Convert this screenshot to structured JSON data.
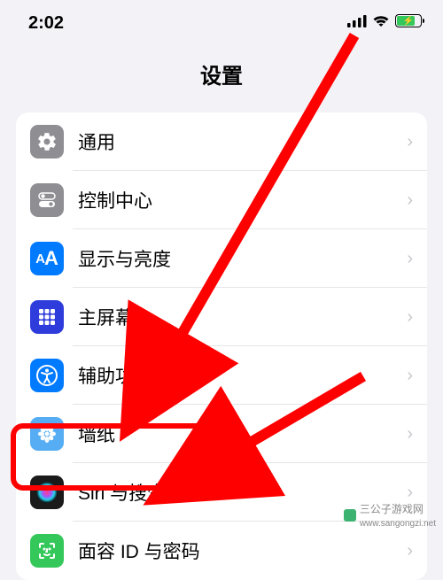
{
  "status": {
    "time": "2:02",
    "signal_strength": 4,
    "wifi": true,
    "battery_charging": true
  },
  "header": {
    "title": "设置"
  },
  "settings_group": [
    {
      "id": "general",
      "label": "通用",
      "icon": "gear-icon",
      "icon_color": "#8e8e93"
    },
    {
      "id": "control-center",
      "label": "控制中心",
      "icon": "switch-icon",
      "icon_color": "#8e8e93"
    },
    {
      "id": "display",
      "label": "显示与亮度",
      "icon": "text-size-icon",
      "icon_color": "#007aff"
    },
    {
      "id": "home-screen",
      "label": "主屏幕",
      "icon": "grid-icon",
      "icon_color": "#2f3cdc"
    },
    {
      "id": "accessibility",
      "label": "辅助功能",
      "icon": "accessibility-icon",
      "icon_color": "#007aff"
    },
    {
      "id": "wallpaper",
      "label": "墙纸",
      "icon": "flower-icon",
      "icon_color": "#56adf3"
    },
    {
      "id": "siri",
      "label": "Siri 与搜索",
      "icon": "siri-icon",
      "icon_color": "#1a1a1a"
    },
    {
      "id": "faceid",
      "label": "面容 ID 与密码",
      "icon": "faceid-icon",
      "icon_color": "#34c759"
    }
  ],
  "annotations": {
    "highlight_row_id": "siri",
    "arrows": 2
  },
  "watermark": {
    "text": "三公子游戏网",
    "url": "www.sangongzi.net"
  }
}
